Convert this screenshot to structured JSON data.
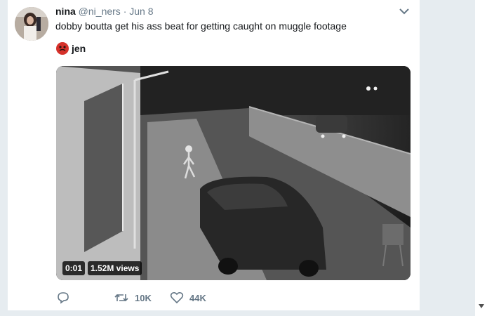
{
  "tweet": {
    "author_name": "nina",
    "author_handle": "@ni_ners",
    "separator": "·",
    "date": "Jun 8",
    "text": "dobby boutta get his ass beat for getting caught on muggle footage",
    "quoted_label": "jen",
    "video": {
      "time": "0:01",
      "views": "1.52M views"
    },
    "actions": {
      "retweets": "10K",
      "likes": "44K"
    }
  },
  "icons": {
    "reply": "reply-icon",
    "retweet": "retweet-icon",
    "like": "heart-icon",
    "more": "chevron-down-icon",
    "quoted_emoji": "red-face-emoji-icon"
  },
  "colors": {
    "accent": "#1da1f2",
    "name": "#14171a",
    "secondary": "#657786",
    "page_bg": "#e6ecf0"
  }
}
